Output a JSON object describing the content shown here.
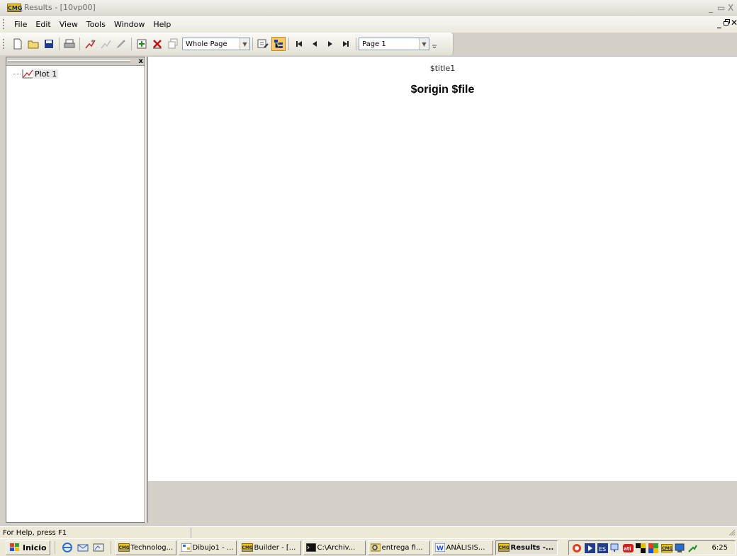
{
  "window": {
    "title": "Results - [10vp00]",
    "logo_text": "CMG",
    "minimize": "_",
    "maximize": "▭",
    "close": "X",
    "child_minimize": "_",
    "child_restore": "🗗",
    "child_close": "✕"
  },
  "menu": {
    "items": [
      "File",
      "Edit",
      "View",
      "Tools",
      "Window",
      "Help"
    ]
  },
  "toolbar": {
    "zoom_value": "Whole Page",
    "page_value": "Page 1"
  },
  "tree": {
    "close": "x",
    "items": [
      {
        "label": "Plot 1",
        "icon": "plot-icon"
      }
    ]
  },
  "page": {
    "title": "$title1",
    "subtitle": "$origin $file"
  },
  "status": {
    "text": "For Help, press F1"
  },
  "taskbar": {
    "start_label": "Inicio",
    "tasks": [
      {
        "label": "Technolog...",
        "icon": "cmg-icon"
      },
      {
        "label": "Dibujo1 - ...",
        "icon": "visio-icon"
      },
      {
        "label": "Builder - [...",
        "icon": "cmg-icon"
      },
      {
        "label": "C:\\Archiv...",
        "icon": "console-icon"
      },
      {
        "label": "entrega fi...",
        "icon": "explorer-icon"
      },
      {
        "label": "ANÁLISIS...",
        "icon": "word-icon"
      },
      {
        "label": "Results -...",
        "icon": "cmg-icon",
        "active": true
      }
    ],
    "clock": "6:25"
  },
  "colors": {
    "accent_yellow": "#f2c400",
    "logo_blue": "#0a2a8a",
    "window_bg": "#d4d0c8"
  }
}
